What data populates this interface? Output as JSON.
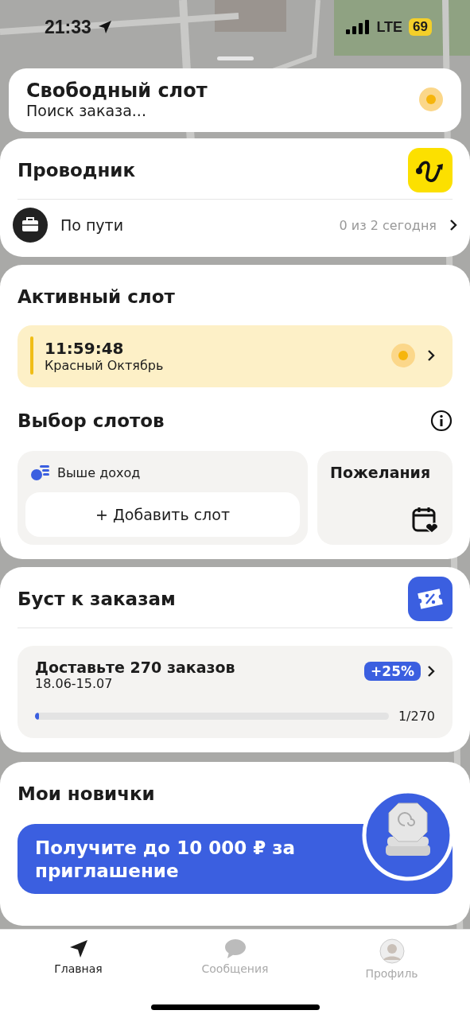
{
  "status_bar": {
    "time": "21:33",
    "network": "LTE",
    "battery": "69"
  },
  "free_slot": {
    "title": "Свободный слот",
    "status": "Поиск заказа..."
  },
  "guide": {
    "title": "Проводник",
    "row": {
      "label": "По пути",
      "progress": "0 из 2 сегодня"
    }
  },
  "active_slot": {
    "title": "Активный слот",
    "time": "11:59:48",
    "place": "Красный Октябрь"
  },
  "slot_choice": {
    "title": "Выбор слотов",
    "tag": "Выше доход",
    "add_button": "+ Добавить слот",
    "wishes": "Пожелания"
  },
  "boost": {
    "title": "Буст к заказам",
    "task": {
      "title": "Доставьте 270 заказов",
      "dates": "18.06-15.07",
      "badge": "+25%",
      "level": 0.004,
      "reading": "1/270"
    }
  },
  "newbies": {
    "title": "Мои новички",
    "banner": "Получите до **10 000 ₽** за приглашение"
  },
  "tab_bar": [
    {
      "kind": "home",
      "label": "Главная",
      "selected": true
    },
    {
      "kind": "messages",
      "label": "Сообщения",
      "selected": false
    },
    {
      "kind": "profile",
      "label": "Профиль",
      "selected": false
    }
  ]
}
